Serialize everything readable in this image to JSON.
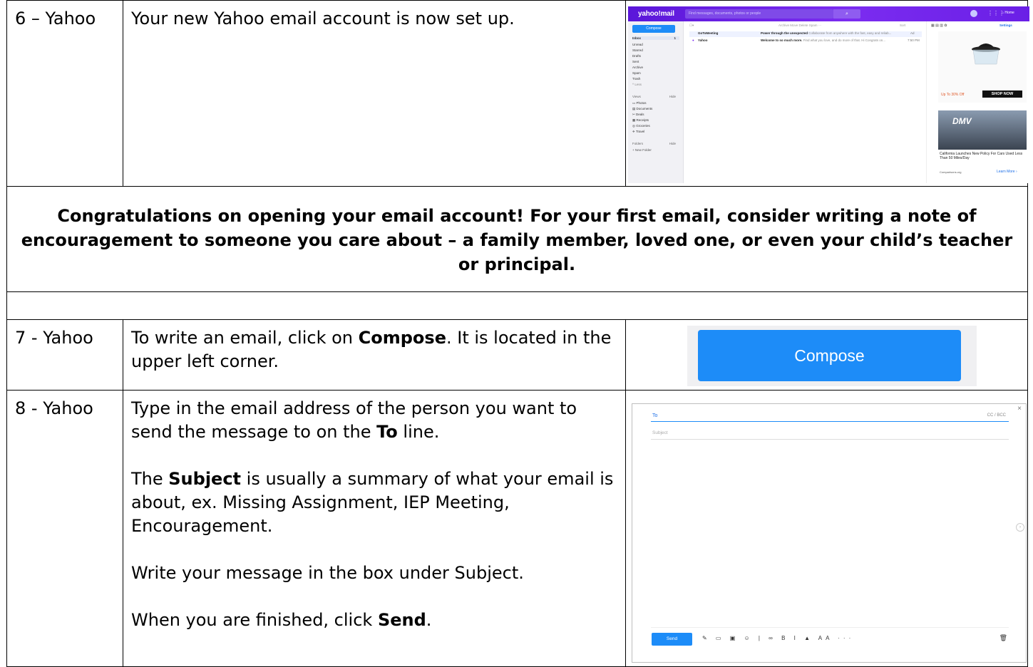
{
  "rows": {
    "r6": {
      "step": "6 – Yahoo",
      "text": "Your new Yahoo email account is now set up."
    },
    "congrats": "Congratulations on opening your email account! For your first email, consider writing a note of encouragement to someone you care about – a family member, loved one, or even your child’s teacher or principal.",
    "r7": {
      "step": "7 - Yahoo",
      "text_before": "To write an email, click on ",
      "text_bold": "Compose",
      "text_after": ". It is located in the upper left corner."
    },
    "r8": {
      "step": "8 - Yahoo",
      "p1_before": "Type in the email address of the person you want to send the message to on the ",
      "p1_bold": "To",
      "p1_after": " line.",
      "p2_bold": "Subject",
      "p2_after": " is usually a summary of what your email is about, ex. Missing Assignment, IEP Meeting, Encouragement.",
      "p2_before": "The ",
      "p3": "Write your message in the box under Subject.",
      "p4_before": "When you are finished, click ",
      "p4_bold": "Send",
      "p4_after": "."
    }
  },
  "inbox_shot": {
    "logo": "yahoo!mail",
    "search_placeholder": "Find messages, documents, photos or people",
    "home": "Home",
    "compose": "Compose",
    "folders": [
      {
        "name": "Inbox",
        "count": "1"
      },
      {
        "name": "Unread",
        "count": ""
      },
      {
        "name": "Starred",
        "count": ""
      },
      {
        "name": "Drafts",
        "count": ""
      },
      {
        "name": "Sent",
        "count": ""
      },
      {
        "name": "Archive",
        "count": ""
      },
      {
        "name": "Spam",
        "count": ""
      },
      {
        "name": "Trash",
        "count": ""
      },
      {
        "name": "^ Less",
        "count": ""
      }
    ],
    "views_label": "Views",
    "views_hide": "Hide",
    "views": [
      "Photos",
      "Documents",
      "Deals",
      "Receipts",
      "Groceries",
      "Travel"
    ],
    "folders_label": "Folders",
    "folders_hide": "Hide",
    "new_folder": "+ New Folder",
    "toolbar": "Archive   Move   Delete   Spam   ···",
    "sort": "Sort",
    "settings": "Settings",
    "msg1": {
      "from": "GoToMeeting",
      "subject": "Power through the unexpected",
      "preview": "Collaborate from anywhere with the fast, easy and reliab...",
      "tag": "Ad"
    },
    "msg2": {
      "from": "Yahoo",
      "subject": "Welcome to so much more.",
      "preview": "Find what you love, and do more of that. Hi   Congrats on...",
      "time": "7:50 PM"
    },
    "ad1_text": "Up To 30% Off",
    "ad1_button": "SHOP NOW",
    "ad2_banner": "DMV",
    "ad2_caption": "California Launches New Policy For Cars Used Less Than 50 Miles/Day",
    "ad2_source": "Comparisons.org",
    "ad2_learn": "Learn More ›"
  },
  "compose_shot": {
    "label": "Compose"
  },
  "form_shot": {
    "to": "To",
    "ccbcc": "CC / BCC",
    "subject": "Subject",
    "send": "Send",
    "tools": "✎ ▭ ▣ ☺ | ∞ B I ▲ AA ···"
  }
}
